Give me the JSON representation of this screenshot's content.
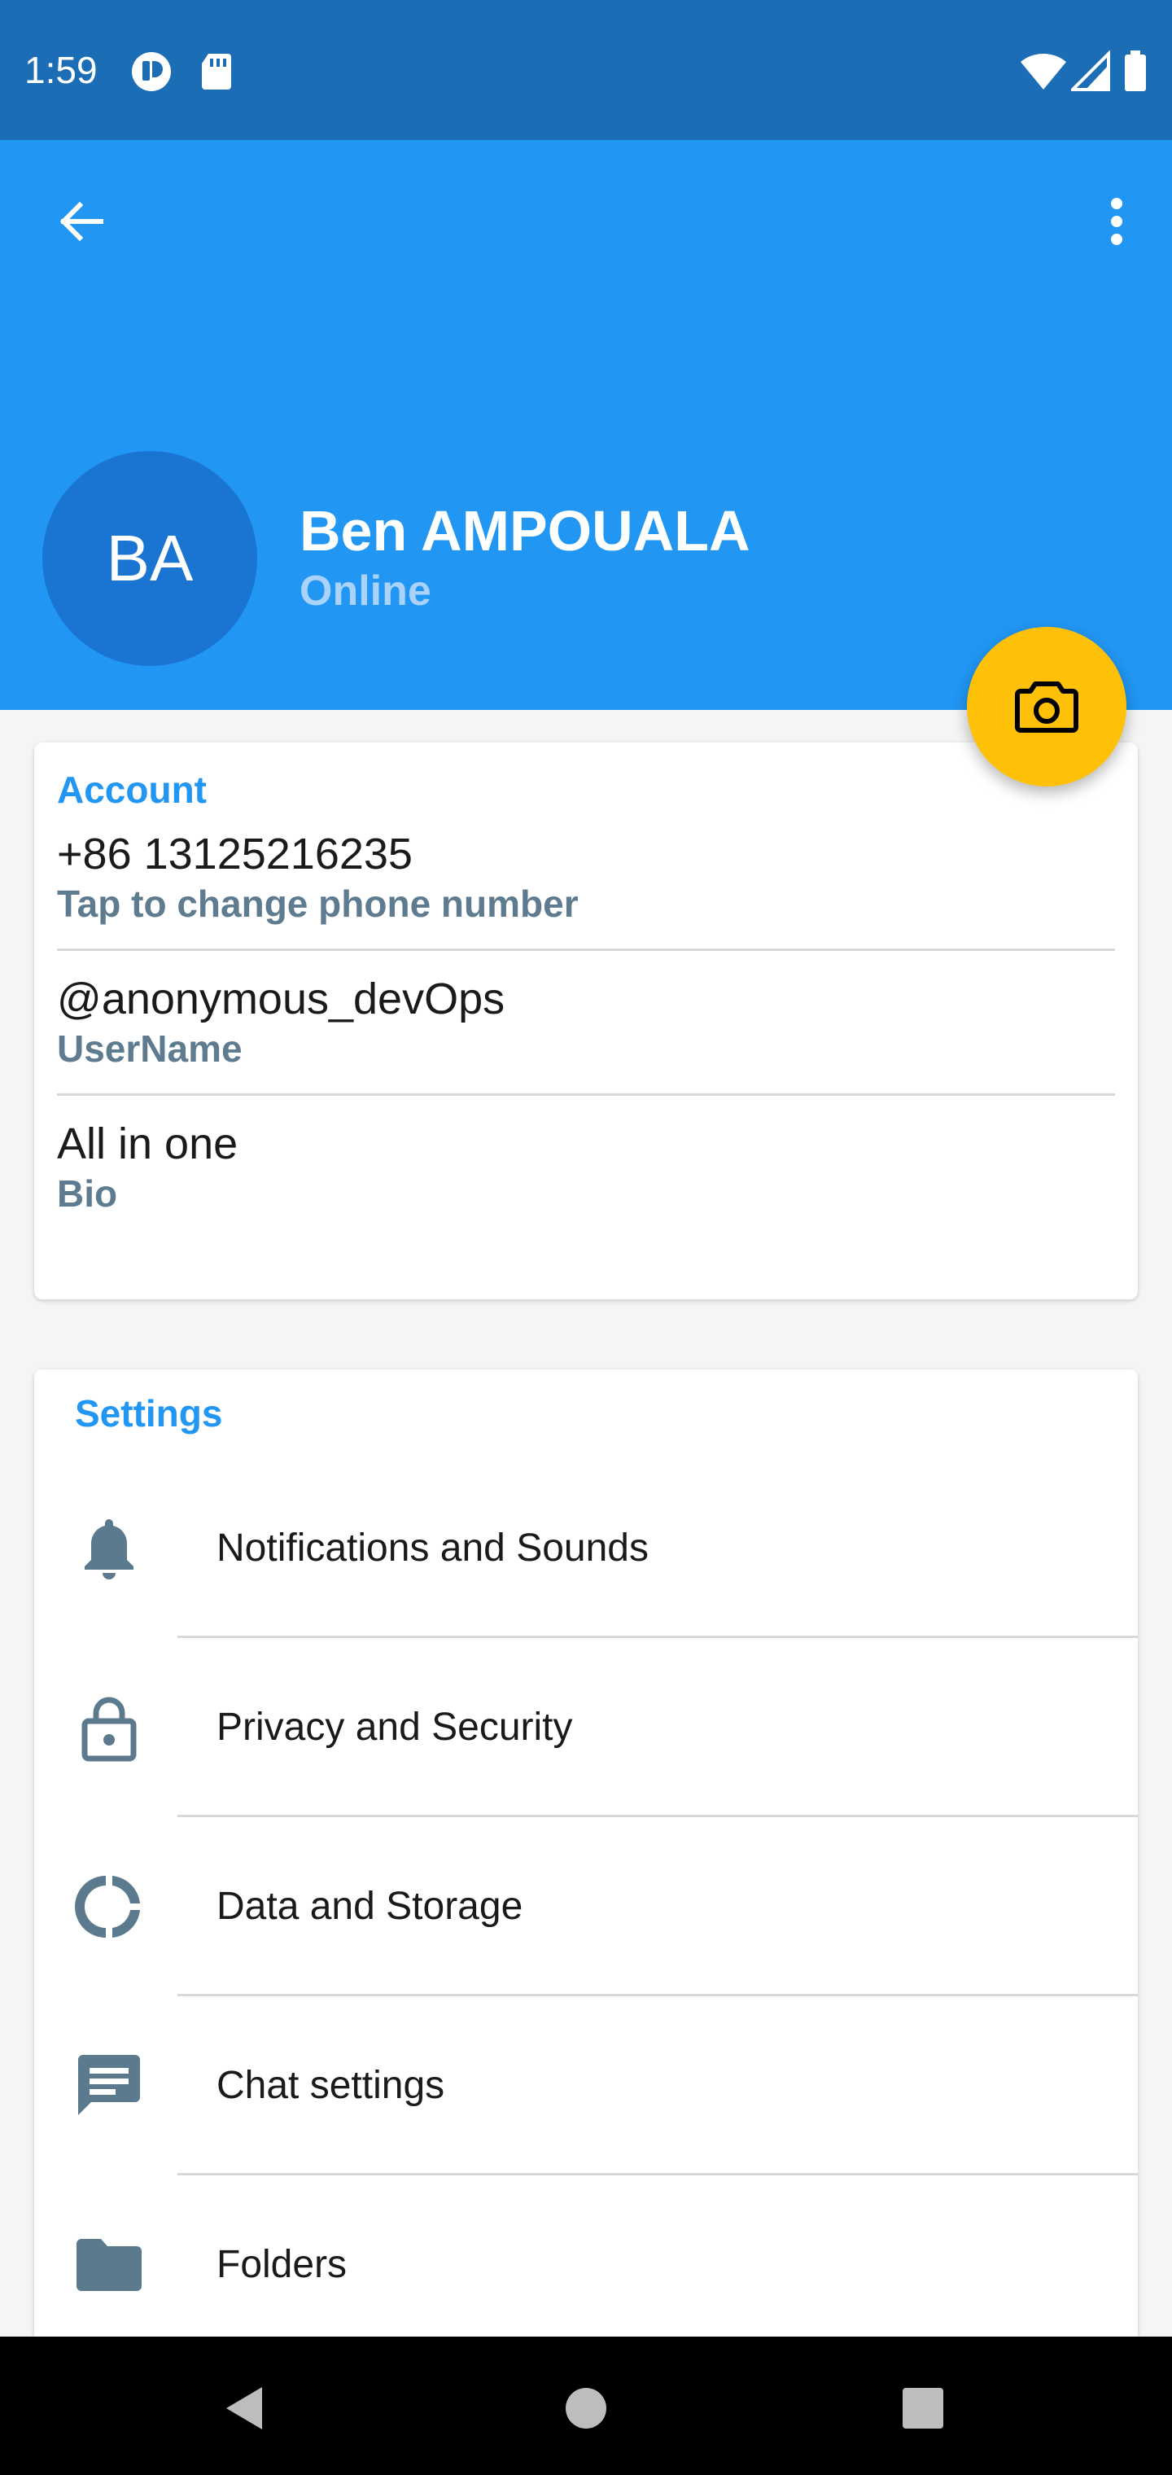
{
  "status_bar": {
    "time": "1:59"
  },
  "header": {
    "avatar_initials": "BA",
    "name": "Ben AMPOUALA",
    "status": "Online"
  },
  "account": {
    "title": "Account",
    "rows": [
      {
        "value": "+86 13125216235",
        "label": "Tap to change phone number"
      },
      {
        "value": "@anonymous_devOps",
        "label": "UserName"
      },
      {
        "value": "All in one",
        "label": "Bio"
      }
    ]
  },
  "settings": {
    "title": "Settings",
    "items": [
      {
        "label": "Notifications and Sounds",
        "icon": "bell-icon"
      },
      {
        "label": "Privacy and Security",
        "icon": "lock-icon"
      },
      {
        "label": "Data and Storage",
        "icon": "pie-chart-icon"
      },
      {
        "label": "Chat settings",
        "icon": "chat-icon"
      },
      {
        "label": "Folders",
        "icon": "folder-icon"
      }
    ]
  },
  "colors": {
    "status_bar": "#1b6db5",
    "header": "#2196f3",
    "avatar": "#1a75d2",
    "fab": "#ffc107",
    "accent": "#2196f3",
    "secondary_text": "#5e7b8f",
    "icon": "#5b7a8e"
  }
}
